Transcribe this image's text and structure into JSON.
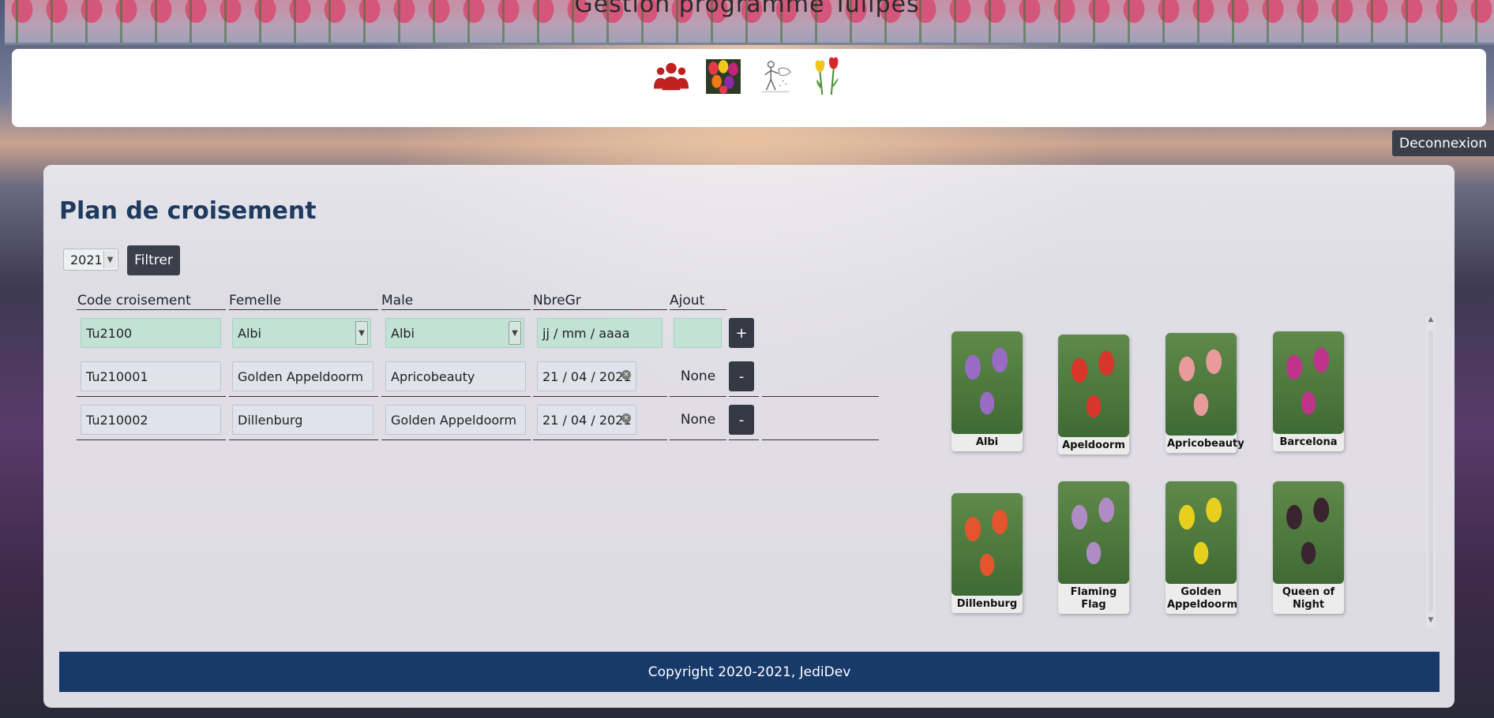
{
  "header": {
    "title": "Gestion programme Tulipes"
  },
  "nav": {
    "icons": [
      "users-icon",
      "tulip-bouquet-icon",
      "gardener-icon",
      "two-tulips-icon"
    ]
  },
  "logout_label": "Deconnexion",
  "page_title": "Plan de croisement",
  "filter": {
    "year": "2021",
    "button_label": "Filtrer"
  },
  "table": {
    "headers": [
      "Code croisement",
      "Femelle",
      "Male",
      "NbreGr",
      "Ajout"
    ],
    "new_row": {
      "code": "Tu2100",
      "femelle": "Albi",
      "male": "Albi",
      "date_placeholder": "jj / mm / aaaa",
      "add_label": "+"
    },
    "rows": [
      {
        "code": "Tu210001",
        "femelle": "Golden Appeldoorm",
        "male": "Apricobeauty",
        "date": "21 / 04 / 2021",
        "nbre": "None",
        "remove_label": "-"
      },
      {
        "code": "Tu210002",
        "femelle": "Dillenburg",
        "male": "Golden Appeldoorm",
        "date": "21 / 04 / 2021",
        "nbre": "None",
        "remove_label": "-"
      }
    ]
  },
  "gallery": [
    {
      "name": "Albi",
      "color": "#9a6bc4"
    },
    {
      "name": "Apeldoorm",
      "color": "#d8352b"
    },
    {
      "name": "Apricobeauty",
      "color": "#e99a9a"
    },
    {
      "name": "Barcelona",
      "color": "#c0338a"
    },
    {
      "name": "Dillenburg",
      "color": "#e4552e"
    },
    {
      "name": "Flaming Flag",
      "color": "#b08cc4"
    },
    {
      "name": "Golden Appeldoorm",
      "color": "#e7cf1e"
    },
    {
      "name": "Queen of Night",
      "color": "#3a2430"
    }
  ],
  "footer": {
    "text": "Copyright 2020-2021, JediDev"
  },
  "colors": {
    "accent": "#1f3a5f",
    "footer": "#173a6a",
    "button": "#3a3f4a"
  }
}
